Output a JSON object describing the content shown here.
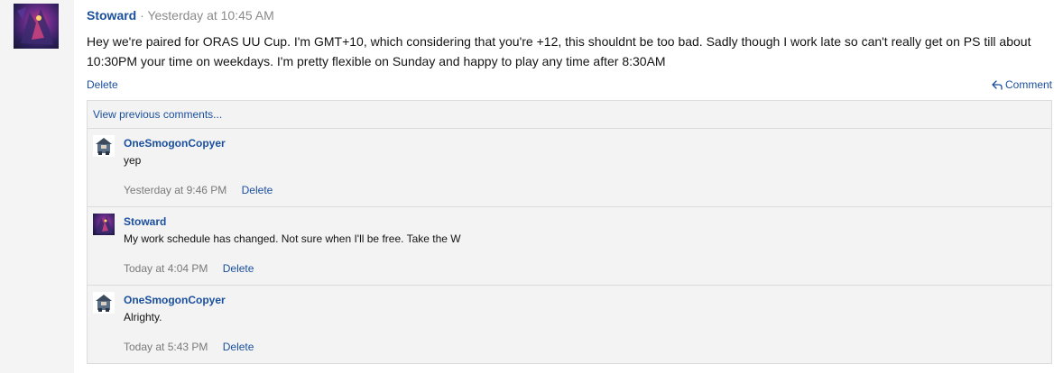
{
  "post": {
    "author": "Stoward",
    "separator": "·",
    "timestamp": "Yesterday at 10:45 AM",
    "body": "Hey we're paired for ORAS UU Cup. I'm GMT+10, which considering that you're +12, this shouldnt be too bad. Sadly though I work late so can't really get on PS till about 10:30PM your time on weekdays. I'm pretty flexible on Sunday and happy to play any time after 8:30AM",
    "delete_label": "Delete",
    "comment_label": "Comment",
    "comment_icon": "reply-icon"
  },
  "comments_section": {
    "view_previous_label": "View previous comments...",
    "comments": [
      {
        "author": "OneSmogonCopyer",
        "avatar": "trainer-avatar",
        "text": "yep",
        "timestamp": "Yesterday at 9:46 PM",
        "delete_label": "Delete"
      },
      {
        "author": "Stoward",
        "avatar": "stoward-avatar",
        "text": "My work schedule has changed. Not sure when I'll be free. Take the W",
        "timestamp": "Today at 4:04 PM",
        "delete_label": "Delete"
      },
      {
        "author": "OneSmogonCopyer",
        "avatar": "trainer-avatar",
        "text": "Alrighty.",
        "timestamp": "Today at 5:43 PM",
        "delete_label": "Delete"
      }
    ]
  },
  "colors": {
    "link": "#1a4f9e",
    "muted": "#8a8a8a",
    "background": "#f4f4f4",
    "card": "#ffffff"
  }
}
